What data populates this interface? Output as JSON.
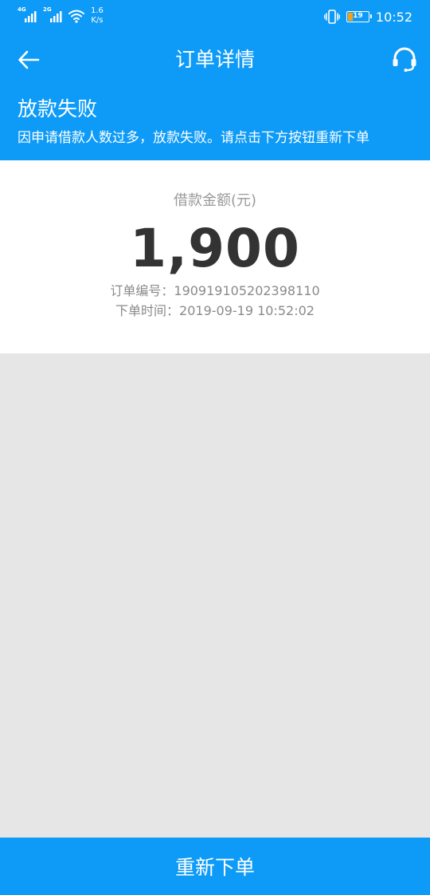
{
  "status_bar": {
    "signal_1_label": "4G",
    "signal_2_label": "2G",
    "speed_value": "1.6",
    "speed_unit": "K/s",
    "battery_level": "19",
    "time": "10:52",
    "icons": [
      "signal-icon",
      "signal-icon",
      "wifi-icon",
      "vibrate-icon",
      "battery-icon"
    ]
  },
  "nav": {
    "title": "订单详情",
    "back_icon": "back-arrow-icon",
    "service_icon": "headset-icon"
  },
  "status": {
    "title": "放款失败",
    "description": "因申请借款人数过多，放款失败。请点击下方按钮重新下单"
  },
  "order": {
    "amount_label": "借款金额(元)",
    "amount": "1,900",
    "order_no_label": "订单编号：",
    "order_no": "190919105202398110",
    "order_time_label": "下单时间：",
    "order_time": "2019-09-19 10:52:02"
  },
  "footer": {
    "reorder_label": "重新下单"
  },
  "colors": {
    "primary": "#0e9bf7",
    "background": "#e6e6e6",
    "card": "#ffffff",
    "amount_text": "#333333",
    "muted_text": "#8a8a8a",
    "battery_low": "#f4a01a"
  }
}
